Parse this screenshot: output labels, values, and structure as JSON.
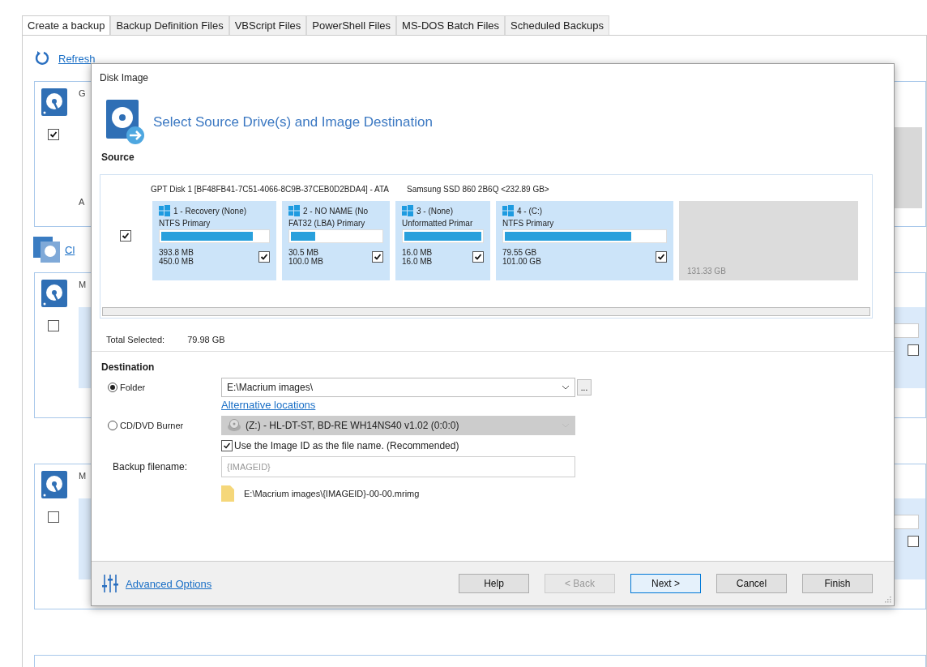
{
  "tabs": [
    {
      "label": "Create a backup",
      "selected": true
    },
    {
      "label": "Backup Definition Files",
      "selected": false
    },
    {
      "label": "VBScript Files",
      "selected": false
    },
    {
      "label": "PowerShell Files",
      "selected": false
    },
    {
      "label": "MS-DOS Batch Files",
      "selected": false
    },
    {
      "label": "Scheduled Backups",
      "selected": false
    }
  ],
  "refresh": "Refresh",
  "background_cards": [
    {
      "header": "G",
      "checked": true,
      "footer": "A"
    },
    {
      "link": "Cl"
    },
    {
      "header": "M",
      "checked": false,
      "right_checked": false
    },
    {
      "header": "M",
      "checked": false,
      "right_checked": false
    }
  ],
  "dialog": {
    "title": "Disk Image",
    "heading": "Select Source Drive(s) and Image Destination",
    "source_label": "Source",
    "disk": {
      "checked": true,
      "name": "GPT Disk 1 [BF48FB41-7C51-4066-8C9B-37CEB0D2BDA4] - ATA",
      "model": "Samsung SSD 860  2B6Q  <232.89 GB>",
      "partitions": [
        {
          "kind": "partition",
          "label": "1 - Recovery (None)",
          "type": "NTFS Primary",
          "level": 0.86,
          "used": "393.8 MB",
          "total": "450.0 MB",
          "checked": true
        },
        {
          "kind": "partition",
          "label": "2 - NO NAME (No",
          "type": "FAT32 (LBA) Primary",
          "level": 0.27,
          "used": "30.5 MB",
          "total": "100.0 MB",
          "checked": true
        },
        {
          "kind": "partition",
          "label": "3 -  (None)",
          "type": "Unformatted Primar",
          "level": 1,
          "used": "16.0 MB",
          "total": "16.0 MB",
          "checked": true
        },
        {
          "kind": "partition",
          "label": "4 - (C:)",
          "type": "NTFS Primary",
          "level": 0.79,
          "used": "79.55 GB",
          "total": "101.00 GB",
          "checked": true
        },
        {
          "kind": "unallocated",
          "size": "131.33 GB"
        }
      ]
    },
    "total_label": "Total Selected:",
    "total_value": "79.98 GB",
    "destination_label": "Destination",
    "folder": {
      "label": "Folder",
      "selected": true,
      "value": "E:\\Macrium images\\",
      "browse": "..."
    },
    "alt_link": "Alternative locations",
    "burner": {
      "label": "CD/DVD Burner",
      "selected": false,
      "value": "(Z:) - HL-DT-ST, BD-RE  WH14NS40  v1.02 (0:0:0)",
      "disabled": true
    },
    "use_image_id": {
      "label": "Use the Image ID as the file name.  (Recommended)",
      "checked": true
    },
    "filename_label": "Backup filename:",
    "filename_placeholder": "{IMAGEID}",
    "path": "E:\\Macrium images\\{IMAGEID}-00-00.mrimg",
    "advanced": "Advanced Options",
    "buttons": [
      {
        "label": "Help",
        "disabled": false,
        "focused": false
      },
      {
        "label": "< Back",
        "disabled": true,
        "focused": false
      },
      {
        "label": "Next >",
        "disabled": false,
        "focused": true
      },
      {
        "label": "Cancel",
        "disabled": false,
        "focused": false
      },
      {
        "label": "Finish",
        "disabled": false,
        "focused": false
      }
    ]
  }
}
